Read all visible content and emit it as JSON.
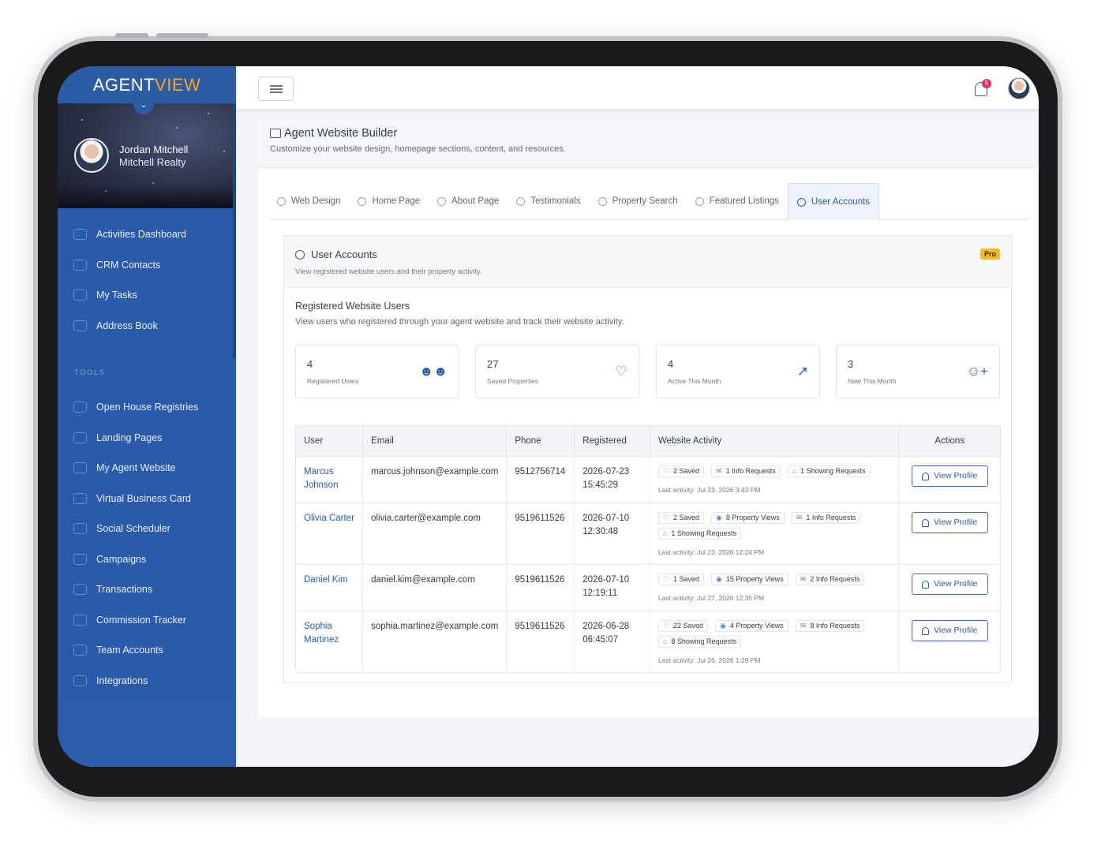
{
  "brand": {
    "part1": "AGENT",
    "part2": "VIEW"
  },
  "profile": {
    "name": "Jordan Mitchell",
    "company": "Mitchell Realty"
  },
  "sidebar": {
    "main_items": [
      {
        "label": "Activities Dashboard",
        "icon": "home-icon"
      },
      {
        "label": "CRM Contacts",
        "icon": "contacts-icon"
      },
      {
        "label": "My Tasks",
        "icon": "tasks-icon"
      },
      {
        "label": "Address Book",
        "icon": "address-book-icon"
      }
    ],
    "tools_label": "TOOLS",
    "tool_items": [
      {
        "label": "Open House Registries",
        "icon": "open-house-icon"
      },
      {
        "label": "Landing Pages",
        "icon": "landing-pages-icon"
      },
      {
        "label": "My Agent Website",
        "icon": "monitor-icon"
      },
      {
        "label": "Virtual Business Card",
        "icon": "business-card-icon"
      },
      {
        "label": "Social Scheduler",
        "icon": "calendar-icon"
      },
      {
        "label": "Campaigns",
        "icon": "campaigns-icon"
      },
      {
        "label": "Transactions",
        "icon": "handshake-icon"
      },
      {
        "label": "Commission Tracker",
        "icon": "commission-icon"
      },
      {
        "label": "Team Accounts",
        "icon": "team-icon"
      },
      {
        "label": "Integrations",
        "icon": "integrations-icon"
      }
    ]
  },
  "topbar": {
    "notification_count": "5"
  },
  "page": {
    "title": "Agent Website Builder",
    "subtitle": "Customize your website design, homepage sections, content, and resources."
  },
  "tabs": [
    {
      "label": "Web Design",
      "icon": "palette-icon"
    },
    {
      "label": "Home Page",
      "icon": "home-icon"
    },
    {
      "label": "About Page",
      "icon": "user-icon"
    },
    {
      "label": "Testimonials",
      "icon": "user-icon"
    },
    {
      "label": "Property Search",
      "icon": "search-icon"
    },
    {
      "label": "Featured Listings",
      "icon": "home-icon"
    },
    {
      "label": "User Accounts",
      "icon": "user-circle-icon",
      "active": true
    }
  ],
  "card": {
    "title": "User Accounts",
    "subtitle": "View registered website users and their property activity.",
    "badge": "Pro",
    "section_title": "Registered Website Users",
    "section_subtitle": "View users who registered through your agent website and track their website activity."
  },
  "stats": [
    {
      "value": "4",
      "label": "Registered Users",
      "icon": "users-icon",
      "color": "#2a5aa8"
    },
    {
      "value": "27",
      "label": "Saved Properties",
      "icon": "heart-icon",
      "color": "#e0456a"
    },
    {
      "value": "4",
      "label": "Active This Month",
      "icon": "chart-up-icon",
      "color": "#2a5aa8"
    },
    {
      "value": "3",
      "label": "New This Month",
      "icon": "user-plus-icon",
      "color": "#2a5aa8"
    }
  ],
  "table": {
    "headers": [
      "User",
      "Email",
      "Phone",
      "Registered",
      "Website Activity",
      "Actions"
    ],
    "rows": [
      {
        "user": "Marcus Johnson",
        "email": "marcus.johnson@example.com",
        "phone": "9512756714",
        "date": "2026-07-23",
        "time": "15:45:29",
        "chips": [
          {
            "icon": "heart",
            "text": "2 Saved"
          },
          {
            "icon": "mail",
            "text": "1 Info Requests"
          },
          {
            "icon": "home",
            "text": "1 Showing Requests"
          }
        ],
        "last": "Last activity: Jul 23, 2026 3:43 PM",
        "action": "View Profile"
      },
      {
        "user": "Olivia Carter",
        "email": "olivia.carter@example.com",
        "phone": "9519611526",
        "date": "2026-07-10",
        "time": "12:30:48",
        "chips": [
          {
            "icon": "heart",
            "text": "2 Saved"
          },
          {
            "icon": "eye",
            "text": "8 Property Views"
          },
          {
            "icon": "mail",
            "text": "1 Info Requests"
          },
          {
            "icon": "home",
            "text": "1 Showing Requests"
          }
        ],
        "last": "Last activity: Jul 23, 2026 12:24 PM",
        "action": "View Profile"
      },
      {
        "user": "Daniel Kim",
        "email": "daniel.kim@example.com",
        "phone": "9519611526",
        "date": "2026-07-10",
        "time": "12:19:11",
        "chips": [
          {
            "icon": "heart",
            "text": "1 Saved"
          },
          {
            "icon": "eye",
            "text": "15 Property Views"
          },
          {
            "icon": "mail",
            "text": "2 Info Requests"
          }
        ],
        "last": "Last activity: Jul 27, 2026 12:35 PM",
        "action": "View Profile"
      },
      {
        "user": "Sophia Martinez",
        "email": "sophia.martinez@example.com",
        "phone": "9519611526",
        "date": "2026-06-28",
        "time": "06:45:07",
        "chips": [
          {
            "icon": "heart",
            "text": "22 Saved"
          },
          {
            "icon": "eye",
            "text": "4 Property Views"
          },
          {
            "icon": "mail",
            "text": "8 Info Requests"
          },
          {
            "icon": "home",
            "text": "8 Showing Requests"
          }
        ],
        "last": "Last activity: Jul 26, 2026 1:29 PM",
        "action": "View Profile"
      }
    ]
  }
}
